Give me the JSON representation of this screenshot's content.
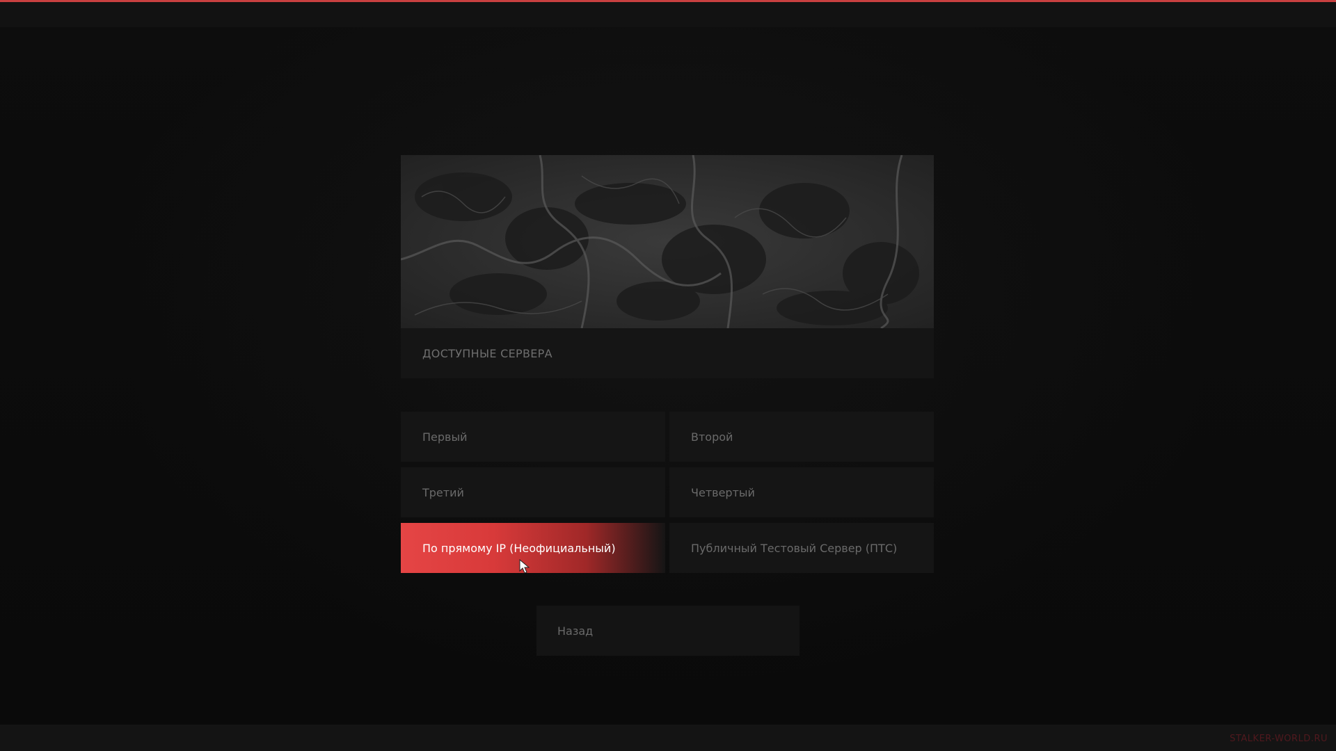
{
  "section": {
    "title": "ДОСТУПНЫЕ СЕРВЕРА"
  },
  "servers": [
    {
      "label": "Первый",
      "selected": false
    },
    {
      "label": "Второй",
      "selected": false
    },
    {
      "label": "Третий",
      "selected": false
    },
    {
      "label": "Четвертый",
      "selected": false
    },
    {
      "label": "По прямому IP (Неофициальный)",
      "selected": true
    },
    {
      "label": "Публичный Тестовый Сервер (ПТС)",
      "selected": false
    }
  ],
  "back_label": "Назад",
  "watermark": "STALKER-WORLD.RU",
  "colors": {
    "accent": "#e54545",
    "background": "#0b0b0b",
    "button": "#151515",
    "text_muted": "#6a6a6a"
  },
  "icons": {
    "cursor": "cursor-arrow-icon"
  }
}
